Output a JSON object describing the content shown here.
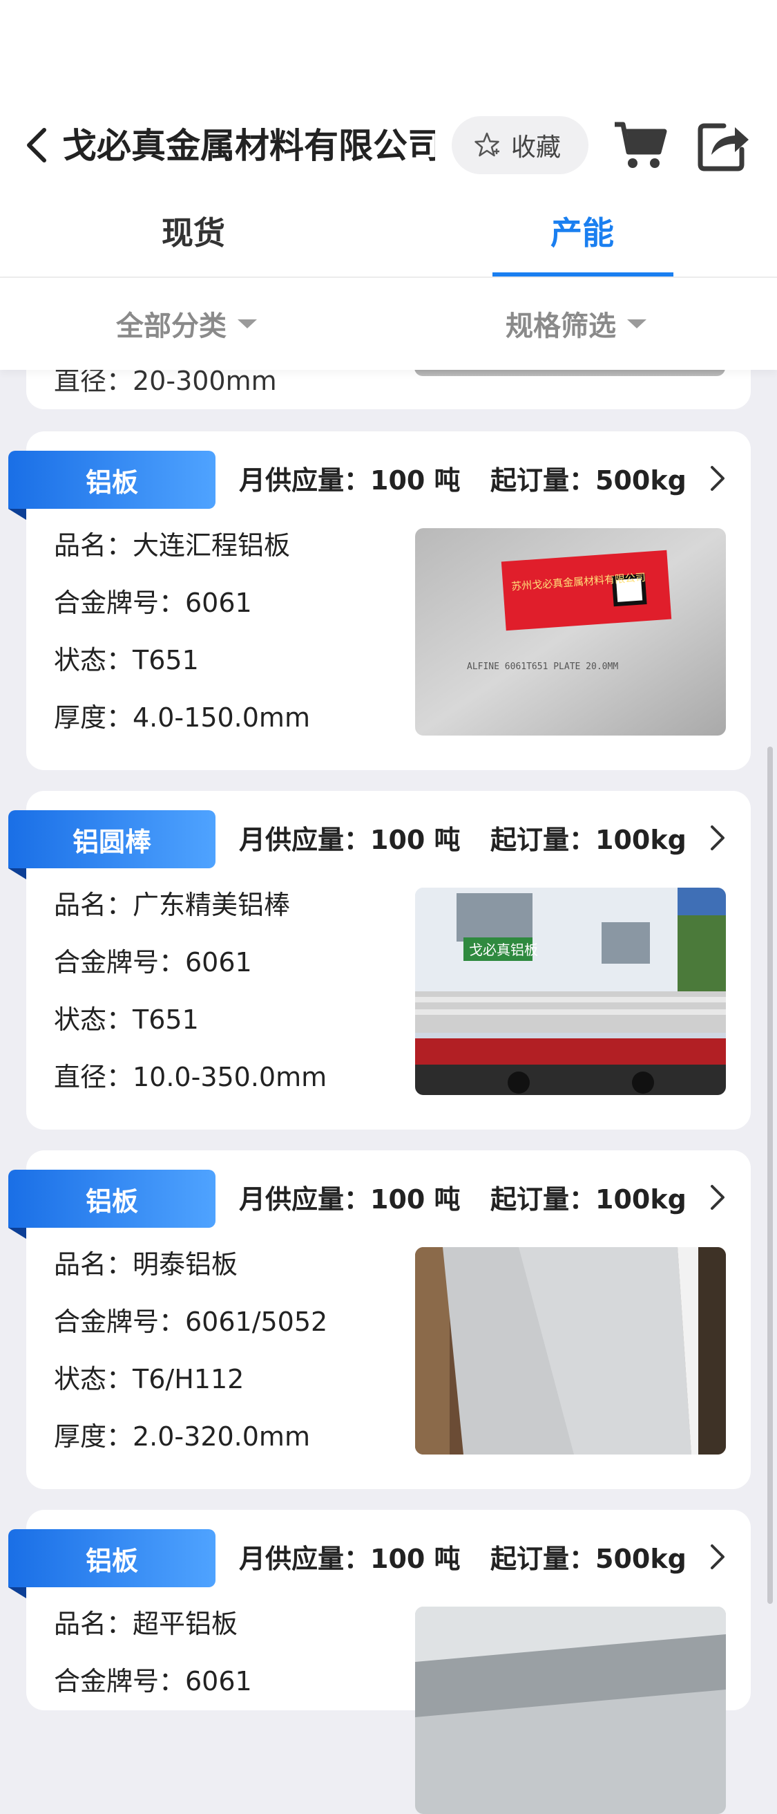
{
  "header": {
    "title": "戈必真金属材料有限公司",
    "favorite_label": "收藏"
  },
  "tabs": [
    {
      "label": "现货",
      "active": false
    },
    {
      "label": "产能",
      "active": true
    }
  ],
  "filters": {
    "category": "全部分类",
    "spec": "规格筛选"
  },
  "partial_card": {
    "text": "直径：20-300mm"
  },
  "products": [
    {
      "tag": "铝板",
      "supply": "月供应量：100 吨",
      "moq": "起订量：500kg",
      "fields": [
        "品名：大连汇程铝板",
        "合金牌号：6061",
        "状态：T651",
        "厚度：4.0-150.0mm"
      ],
      "image_text": {
        "company": "苏州戈必真金属材料有限公司",
        "plate": "ALFINE 6061T651 PLATE 20.0MM"
      }
    },
    {
      "tag": "铝圆棒",
      "supply": "月供应量：100 吨",
      "moq": "起订量：100kg",
      "fields": [
        "品名：广东精美铝棒",
        "合金牌号：6061",
        "状态：T651",
        "直径：10.0-350.0mm"
      ],
      "image_text": {
        "sign": "戈必真铝板"
      }
    },
    {
      "tag": "铝板",
      "supply": "月供应量：100 吨",
      "moq": "起订量：100kg",
      "fields": [
        "品名：明泰铝板",
        "合金牌号：6061/5052",
        "状态：T6/H112",
        "厚度：2.0-320.0mm"
      ]
    },
    {
      "tag": "铝板",
      "supply": "月供应量：100 吨",
      "moq": "起订量：500kg",
      "fields": [
        "品名：超平铝板",
        "合金牌号：6061"
      ]
    }
  ],
  "colors": {
    "accent": "#1a7ff0",
    "background": "#eeeef3"
  }
}
